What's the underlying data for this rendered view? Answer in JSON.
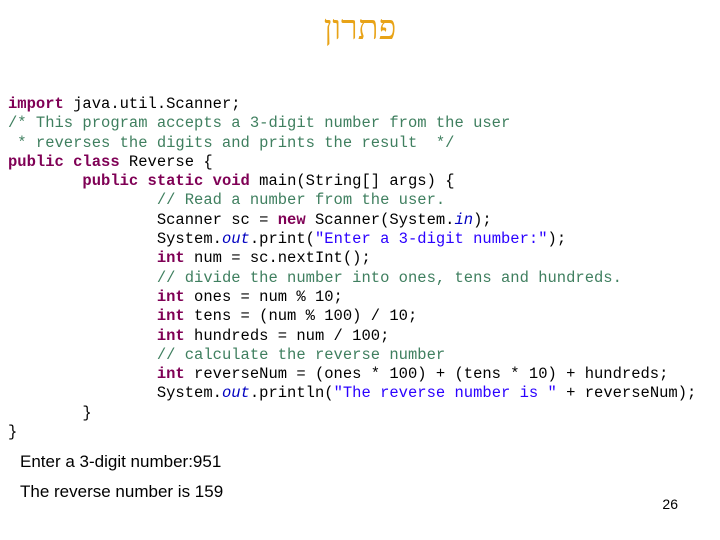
{
  "slide": {
    "title": "פתרון",
    "page_number": "26"
  },
  "code": {
    "colors": {
      "keyword": "#7F0055",
      "comment": "#3F7F5F",
      "string": "#2A00FF",
      "static_field": "#0000C0"
    },
    "lines": [
      [
        {
          "t": "import",
          "c": "kw"
        },
        {
          "t": " java.util.Scanner;"
        }
      ],
      [
        {
          "t": "/* This program accepts a 3-digit number from the user",
          "c": "cm"
        }
      ],
      [
        {
          "t": " * reverses the digits and prints the result  */",
          "c": "cm"
        }
      ],
      [
        {
          "t": "public class",
          "c": "kw"
        },
        {
          "t": " Reverse {"
        }
      ],
      [
        {
          "t": "        "
        },
        {
          "t": "public static void",
          "c": "kw"
        },
        {
          "t": " main(String[] args) {"
        }
      ],
      [
        {
          "t": "                "
        },
        {
          "t": "// Read a number from the user.",
          "c": "cm"
        }
      ],
      [
        {
          "t": "                Scanner sc = "
        },
        {
          "t": "new",
          "c": "kw"
        },
        {
          "t": " Scanner(System."
        },
        {
          "t": "in",
          "c": "fld"
        },
        {
          "t": ");"
        }
      ],
      [
        {
          "t": "                System."
        },
        {
          "t": "out",
          "c": "fld"
        },
        {
          "t": ".print("
        },
        {
          "t": "\"Enter a 3-digit number:\"",
          "c": "str"
        },
        {
          "t": ");"
        }
      ],
      [
        {
          "t": "                "
        },
        {
          "t": "int",
          "c": "kw"
        },
        {
          "t": " num = sc.nextInt();"
        }
      ],
      [
        {
          "t": "                "
        },
        {
          "t": "// divide the number into ones, tens and hundreds.",
          "c": "cm"
        }
      ],
      [
        {
          "t": "                "
        },
        {
          "t": "int",
          "c": "kw"
        },
        {
          "t": " ones = num % 10;"
        }
      ],
      [
        {
          "t": "                "
        },
        {
          "t": "int",
          "c": "kw"
        },
        {
          "t": " tens = (num % 100) / 10;"
        }
      ],
      [
        {
          "t": "                "
        },
        {
          "t": "int",
          "c": "kw"
        },
        {
          "t": " hundreds = num / 100;"
        }
      ],
      [
        {
          "t": "                "
        },
        {
          "t": "// calculate the reverse number",
          "c": "cm"
        }
      ],
      [
        {
          "t": "                "
        },
        {
          "t": "int",
          "c": "kw"
        },
        {
          "t": " reverseNum = (ones * 100) + (tens * 10) + hundreds;"
        }
      ],
      [
        {
          "t": "                System."
        },
        {
          "t": "out",
          "c": "fld"
        },
        {
          "t": ".println("
        },
        {
          "t": "\"The reverse number is \"",
          "c": "str"
        },
        {
          "t": " + reverseNum);"
        }
      ],
      [
        {
          "t": "        }"
        }
      ],
      [
        {
          "t": "}"
        }
      ]
    ]
  },
  "output": {
    "line1": "Enter a 3-digit number:951",
    "line2": "The reverse number is 159"
  }
}
